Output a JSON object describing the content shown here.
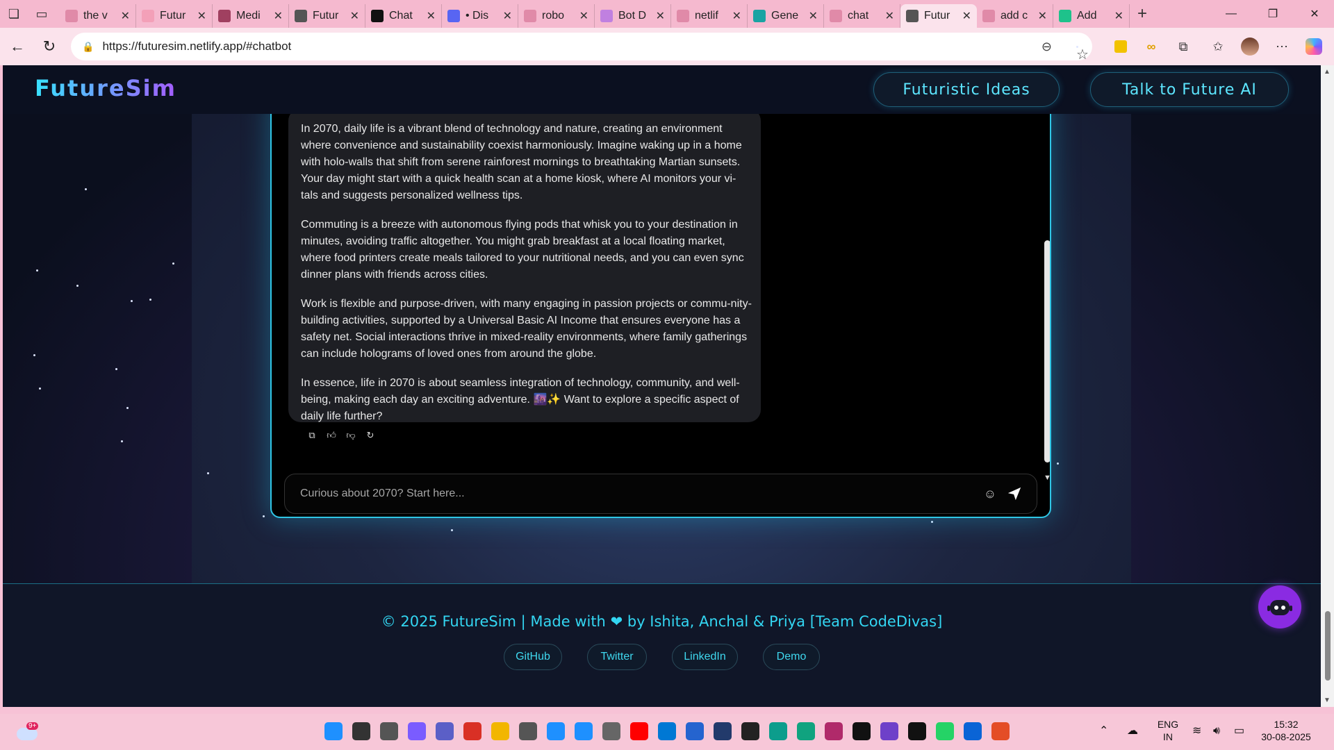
{
  "browser": {
    "tabs": [
      {
        "label": "the v",
        "icon": "search-icon",
        "color": "#e08aa8"
      },
      {
        "label": "Futur",
        "icon": "page-icon",
        "color": "#f3a0b8"
      },
      {
        "label": "Medi",
        "icon": "m-icon",
        "color": "#a04060"
      },
      {
        "label": "Futur",
        "icon": "globe-icon",
        "color": "#555555"
      },
      {
        "label": "Chat",
        "icon": "c-icon",
        "color": "#111111"
      },
      {
        "label": "• Dis",
        "icon": "discord-icon",
        "color": "#5865f2"
      },
      {
        "label": "robo",
        "icon": "search-icon",
        "color": "#e08aa8"
      },
      {
        "label": "Bot D",
        "icon": "grid-icon",
        "color": "#c080e0"
      },
      {
        "label": "netlif",
        "icon": "search-icon",
        "color": "#e08aa8"
      },
      {
        "label": "Gene",
        "icon": "diamond-icon",
        "color": "#1aa3a3"
      },
      {
        "label": "chat",
        "icon": "search-icon",
        "color": "#e08aa8"
      },
      {
        "label": "Futur",
        "icon": "globe-icon",
        "color": "#555555"
      },
      {
        "label": "add c",
        "icon": "search-icon",
        "color": "#e08aa8"
      },
      {
        "label": "Add",
        "icon": "play-icon",
        "color": "#1ec28b"
      }
    ],
    "active_tab_index": 11,
    "url": "https://futuresim.netlify.app/#chatbot"
  },
  "site": {
    "brand": "FutureSim",
    "nav": {
      "ideas": "Futuristic Ideas",
      "talk": "Talk to Future AI"
    }
  },
  "chat": {
    "paragraphs": [
      "In 2070, daily life is a vibrant blend of technology and nature, creating an environment where convenience and sustainability coexist harmoniously. Imagine waking up in a home with holo-walls that shift from serene rainforest mornings to breathtaking Martian sunsets. Your day might start with a quick health scan at a home kiosk, where AI monitors your vi-tals and suggests personalized wellness tips.",
      "Commuting is a breeze with autonomous flying pods that whisk you to your destination in minutes, avoiding traffic altogether. You might grab breakfast at a local floating market, where food printers create meals tailored to your nutritional needs, and you can even sync dinner plans with friends across cities.",
      "Work is flexible and purpose-driven, with many engaging in passion projects or commu-nity-building activities, supported by a Universal Basic AI Income that ensures everyone has a safety net. Social interactions thrive in mixed-reality environments, where family gatherings can include holograms of loved ones from around the globe.",
      "In essence, life in 2070 is about seamless integration of technology, community, and well-being, making each day an exciting adventure. 🌆✨ Want to explore a specific aspect of daily life further?"
    ],
    "input_placeholder": "Curious about 2070? Start here..."
  },
  "footer": {
    "credit_prefix": "© 2025 FutureSim | Made with",
    "credit_suffix": "by Ishita, Anchal & Priya [Team CodeDivas]",
    "links": [
      "GitHub",
      "Twitter",
      "LinkedIn",
      "Demo"
    ]
  },
  "taskbar": {
    "weather_badge": "9+",
    "lang_line1": "ENG",
    "lang_line2": "IN",
    "time": "15:32",
    "date": "30-08-2025"
  },
  "colors": {
    "accent": "#33d6f2",
    "brand_gradient_start": "#38e1ff",
    "brand_gradient_end": "#a45cff",
    "bot_fab": "#8a2be2"
  }
}
